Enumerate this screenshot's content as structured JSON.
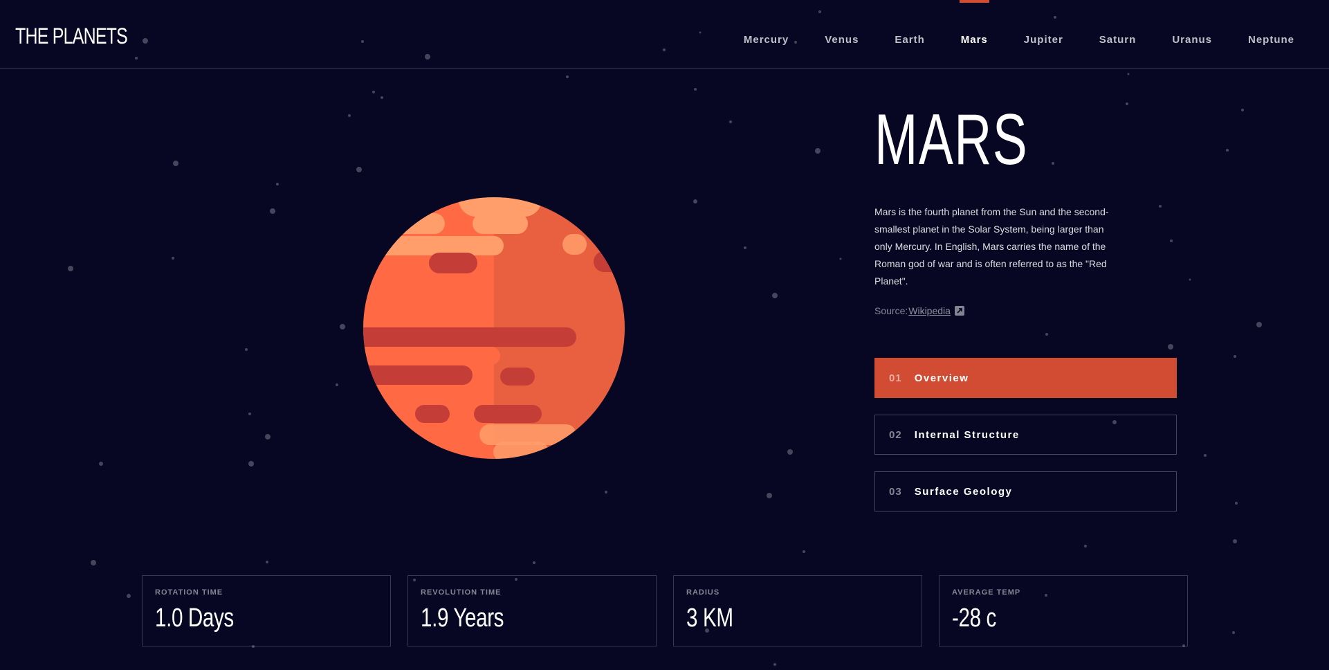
{
  "app": {
    "logo": "THE PLANETS"
  },
  "nav": {
    "items": [
      {
        "label": "Mercury",
        "active": false
      },
      {
        "label": "Venus",
        "active": false
      },
      {
        "label": "Earth",
        "active": false
      },
      {
        "label": "Mars",
        "active": true
      },
      {
        "label": "Jupiter",
        "active": false
      },
      {
        "label": "Saturn",
        "active": false
      },
      {
        "label": "Uranus",
        "active": false
      },
      {
        "label": "Neptune",
        "active": false
      }
    ],
    "accent_color": "#D14C32"
  },
  "planet": {
    "name": "MARS",
    "description": "Mars is the fourth planet from the Sun and the second-smallest planet in the Solar System, being larger than only Mercury. In English, Mars carries the name of the Roman god of war and is often referred to as the \"Red Planet\".",
    "source_label": "Source:",
    "source_link": "Wikipedia",
    "source_icon": "external-link-icon",
    "colors": {
      "primary": "#FF6A45",
      "shade": "#E8603F",
      "dark_band": "#C53D37",
      "light_band": "#FF9E6A"
    }
  },
  "tabs": [
    {
      "num": "01",
      "label": "Overview",
      "active": true
    },
    {
      "num": "02",
      "label": "Internal Structure",
      "active": false
    },
    {
      "num": "03",
      "label": "Surface Geology",
      "active": false
    }
  ],
  "stats": [
    {
      "label": "ROTATION TIME",
      "value": "1.0 Days"
    },
    {
      "label": "REVOLUTION TIME",
      "value": "1.9 Years"
    },
    {
      "label": "RADIUS",
      "value": "3 KM"
    },
    {
      "label": "AVERAGE TEMP",
      "value": "-28 c"
    }
  ],
  "theme": {
    "background": "#070724"
  }
}
